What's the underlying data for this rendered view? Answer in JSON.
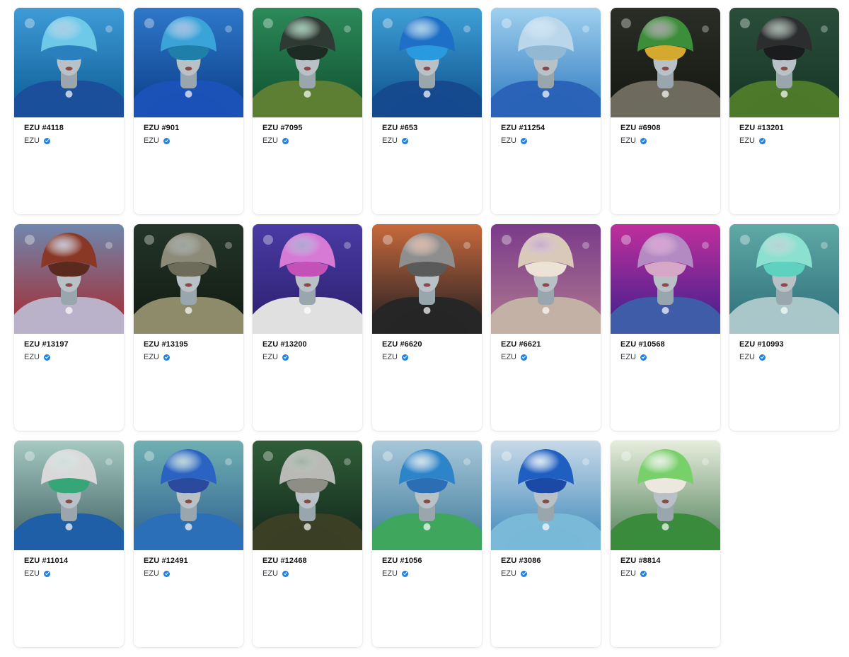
{
  "collection_name": "EZU",
  "verified_badge": "verified-check-icon",
  "items": [
    {
      "title": "EZU #4118",
      "collection": "EZU",
      "bg_top": "#3f9bd6",
      "bg_bottom": "#0b5a93",
      "head": "#6ec9e8",
      "body": "#1b4f9c",
      "mask": "#2a7fbf"
    },
    {
      "title": "EZU #901",
      "collection": "EZU",
      "bg_top": "#2f78c9",
      "bg_bottom": "#0a3c87",
      "head": "#3aa4d8",
      "body": "#1a52b8",
      "mask": "#1f7fa8"
    },
    {
      "title": "EZU #7095",
      "collection": "EZU",
      "bg_top": "#2c8a59",
      "bg_bottom": "#0f4e2f",
      "head": "#2f3a34",
      "body": "#5d7f33",
      "mask": "#1e2a24"
    },
    {
      "title": "EZU #653",
      "collection": "EZU",
      "bg_top": "#3fa0d6",
      "bg_bottom": "#0c4e8a",
      "head": "#1e6fc8",
      "body": "#164a8f",
      "mask": "#2a9ae0"
    },
    {
      "title": "EZU #11254",
      "collection": "EZU",
      "bg_top": "#9fd0ee",
      "bg_bottom": "#2c78bf",
      "head": "#b9d6ea",
      "body": "#2a63b8",
      "mask": "#93b8d4"
    },
    {
      "title": "EZU #6908",
      "collection": "EZU",
      "bg_top": "#2a2e27",
      "bg_bottom": "#14160f",
      "head": "#3d8e3a",
      "body": "#6e6b5e",
      "mask": "#d4a92f"
    },
    {
      "title": "EZU #13201",
      "collection": "EZU",
      "bg_top": "#2a4e3a",
      "bg_bottom": "#173525",
      "head": "#2c2d2e",
      "body": "#4c7a2a",
      "mask": "#1b1c1d"
    },
    {
      "title": "EZU #13197",
      "collection": "EZU",
      "bg_top": "#6f87ad",
      "bg_bottom": "#a8262b",
      "head": "#8a3826",
      "body": "#b9b2c9",
      "mask": "#5b2a1f"
    },
    {
      "title": "EZU #13195",
      "collection": "EZU",
      "bg_top": "#24352a",
      "bg_bottom": "#10190f",
      "head": "#8c8a79",
      "body": "#8d8b6a",
      "mask": "#6d6b5a"
    },
    {
      "title": "EZU #13200",
      "collection": "EZU",
      "bg_top": "#4a3aa5",
      "bg_bottom": "#2a1f6a",
      "head": "#d67ad6",
      "body": "#e0e0e0",
      "mask": "#c451b8"
    },
    {
      "title": "EZU #6620",
      "collection": "EZU",
      "bg_top": "#c86a3c",
      "bg_bottom": "#1c1c22",
      "head": "#8e8e8e",
      "body": "#262626",
      "mask": "#5a5a5a"
    },
    {
      "title": "EZU #6621",
      "collection": "EZU",
      "bg_top": "#7a3a8a",
      "bg_bottom": "#b07a90",
      "head": "#d8c9b8",
      "body": "#c4b1a5",
      "mask": "#ece2d6"
    },
    {
      "title": "EZU #10568",
      "collection": "EZU",
      "bg_top": "#c02f9c",
      "bg_bottom": "#3a1f8e",
      "head": "#b38ac2",
      "body": "#3f5ca8",
      "mask": "#d7a7c7"
    },
    {
      "title": "EZU #10993",
      "collection": "EZU",
      "bg_top": "#5fa9a6",
      "bg_bottom": "#2c6c78",
      "head": "#8ce0cf",
      "body": "#a9c7c9",
      "mask": "#5fd1bf"
    },
    {
      "title": "EZU #11014",
      "collection": "EZU",
      "bg_top": "#a6c9c1",
      "bg_bottom": "#3f5f63",
      "head": "#d9d9d9",
      "body": "#1f5fa8",
      "mask": "#36a679"
    },
    {
      "title": "EZU #12491",
      "collection": "EZU",
      "bg_top": "#6fb0b2",
      "bg_bottom": "#2d5e8f",
      "head": "#2a63c2",
      "body": "#2b6fb8",
      "mask": "#2b4a9e"
    },
    {
      "title": "EZU #12468",
      "collection": "EZU",
      "bg_top": "#2f5e38",
      "bg_bottom": "#12251a",
      "head": "#b9b9b6",
      "body": "#3b3f24",
      "mask": "#8e8e86"
    },
    {
      "title": "EZU #1056",
      "collection": "EZU",
      "bg_top": "#a7c7d9",
      "bg_bottom": "#3d7a9a",
      "head": "#2e84c9",
      "body": "#3fa65e",
      "mask": "#2c6eb6"
    },
    {
      "title": "EZU #3086",
      "collection": "EZU",
      "bg_top": "#c7d9e8",
      "bg_bottom": "#3c86b8",
      "head": "#1f5fc2",
      "body": "#7ab9d8",
      "mask": "#1a49a6"
    },
    {
      "title": "EZU #8814",
      "collection": "EZU",
      "bg_top": "#e6eddc",
      "bg_bottom": "#4e7e58",
      "head": "#78d06a",
      "body": "#3a8c3c",
      "mask": "#ece8df"
    }
  ]
}
